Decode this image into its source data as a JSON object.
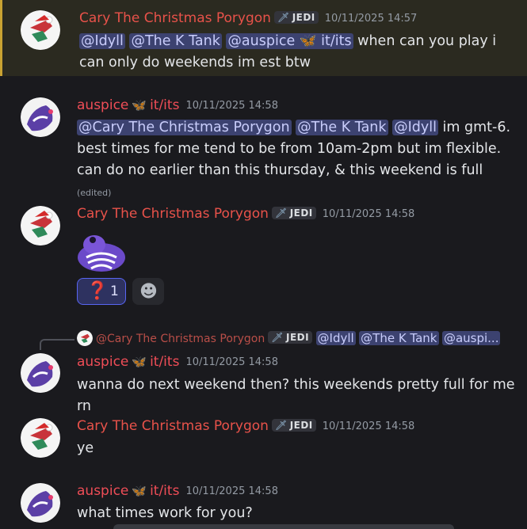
{
  "users": {
    "cary": "Cary The Christmas Porygon",
    "auspice": "auspice",
    "auspice_pronouns": "it/its",
    "tag_label": "JEDI",
    "butterfly": "🦋",
    "sword": "🗡"
  },
  "colors": {
    "cary_name": "#e8524a",
    "auspice_name": "#ef4d57",
    "mention_bg": "#3c4270",
    "highlight_border": "#c9a232"
  },
  "messages": [
    {
      "time": "10/11/2025 14:57",
      "mentions": [
        "@Idyll",
        "@The K Tank",
        "@auspice 🦋 it/its"
      ],
      "text": " when can you play i can only do weekends im est btw"
    },
    {
      "time": "10/11/2025 14:58",
      "mentions": [
        "@Cary The Christmas Porygon",
        "@The K Tank",
        "@Idyll"
      ],
      "text": " im gmt-6. best times for me tend to be from 10am-2pm but im flexible. can do no earlier than this thursday, & this weekend is full ",
      "edited": "(edited)"
    },
    {
      "time": "10/11/2025 14:58",
      "sticker": "purple-frog-sticker",
      "reaction_emoji": "❓",
      "reaction_count": "1",
      "add_reaction_icon": "☻"
    },
    {
      "time": "10/11/2025 14:58",
      "reply": {
        "author": "@Cary The Christmas Porygon",
        "mentions": [
          "@Idyll",
          "@The K Tank",
          "@auspi..."
        ]
      },
      "text": "wanna do next weekend then? this weekends pretty full for me rn"
    },
    {
      "time": "10/11/2025 14:58",
      "text": "ye"
    },
    {
      "time": "10/11/2025 14:58",
      "text": "what times work for you?"
    }
  ]
}
